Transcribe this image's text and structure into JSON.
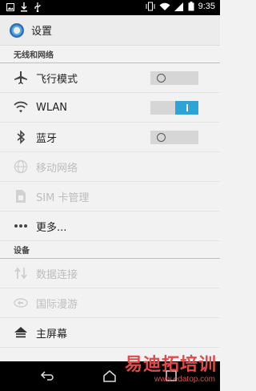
{
  "status_bar": {
    "time": "9:35"
  },
  "app_bar": {
    "title": "设置"
  },
  "sections": [
    {
      "header": "无线和网络",
      "rows": [
        {
          "label": "飞行模式",
          "icon": "airplane-icon",
          "toggle": "off",
          "enabled": true
        },
        {
          "label": "WLAN",
          "icon": "wifi-icon",
          "toggle": "on",
          "enabled": true
        },
        {
          "label": "蓝牙",
          "icon": "bluetooth-icon",
          "toggle": "off",
          "enabled": true
        },
        {
          "label": "移动网络",
          "icon": "globe-icon",
          "enabled": false
        },
        {
          "label": "SIM 卡管理",
          "icon": "sim-card-icon",
          "enabled": false
        },
        {
          "label": "更多...",
          "icon": "more-dots-icon",
          "enabled": true
        }
      ]
    },
    {
      "header": "设备",
      "rows": [
        {
          "label": "数据连接",
          "icon": "data-arrows-icon",
          "enabled": false
        },
        {
          "label": "国际漫游",
          "icon": "roaming-icon",
          "enabled": false
        },
        {
          "label": "主屏幕",
          "icon": "home-icon",
          "enabled": true
        }
      ]
    }
  ],
  "watermark": {
    "main": "易迪拓培训",
    "sub": "www.edatop.com"
  },
  "colors": {
    "accent": "#2ea3d8",
    "background": "#f2f2f2",
    "status_bar": "#000000"
  }
}
